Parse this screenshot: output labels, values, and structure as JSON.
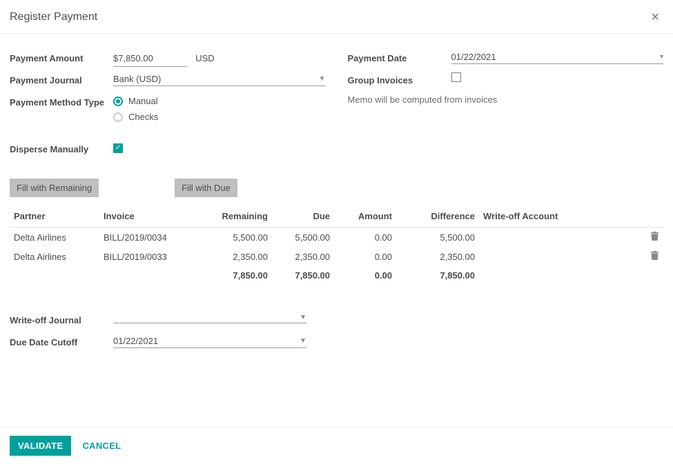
{
  "header": {
    "title": "Register Payment"
  },
  "form": {
    "payment_amount": {
      "label": "Payment Amount",
      "prefix": "$",
      "value": "7,850.00",
      "currency": "USD"
    },
    "payment_journal": {
      "label": "Payment Journal",
      "value": "Bank (USD)"
    },
    "payment_method_type": {
      "label": "Payment Method Type",
      "options": [
        {
          "label": "Manual",
          "checked": true
        },
        {
          "label": "Checks",
          "checked": false
        }
      ]
    },
    "disperse_manually": {
      "label": "Disperse Manually",
      "checked": true
    },
    "payment_date": {
      "label": "Payment Date",
      "value": "01/22/2021"
    },
    "group_invoices": {
      "label": "Group Invoices",
      "checked": false
    },
    "memo_note": "Memo will be computed from invoices"
  },
  "buttons": {
    "fill_remaining": "Fill with Remaining",
    "fill_due": "Fill with Due",
    "validate": "VALIDATE",
    "cancel": "CANCEL"
  },
  "table": {
    "headers": {
      "partner": "Partner",
      "invoice": "Invoice",
      "remaining": "Remaining",
      "due": "Due",
      "amount": "Amount",
      "difference": "Difference",
      "writeoff_account": "Write-off Account"
    },
    "rows": [
      {
        "partner": "Delta Airlines",
        "invoice": "BILL/2019/0034",
        "remaining": "5,500.00",
        "due": "5,500.00",
        "amount": "0.00",
        "difference": "5,500.00",
        "writeoff_account": ""
      },
      {
        "partner": "Delta Airlines",
        "invoice": "BILL/2019/0033",
        "remaining": "2,350.00",
        "due": "2,350.00",
        "amount": "0.00",
        "difference": "2,350.00",
        "writeoff_account": ""
      }
    ],
    "totals": {
      "remaining": "7,850.00",
      "due": "7,850.00",
      "amount": "0.00",
      "difference": "7,850.00"
    }
  },
  "bottom_form": {
    "writeoff_journal": {
      "label": "Write-off Journal",
      "value": ""
    },
    "due_date_cutoff": {
      "label": "Due Date Cutoff",
      "value": "01/22/2021"
    }
  }
}
